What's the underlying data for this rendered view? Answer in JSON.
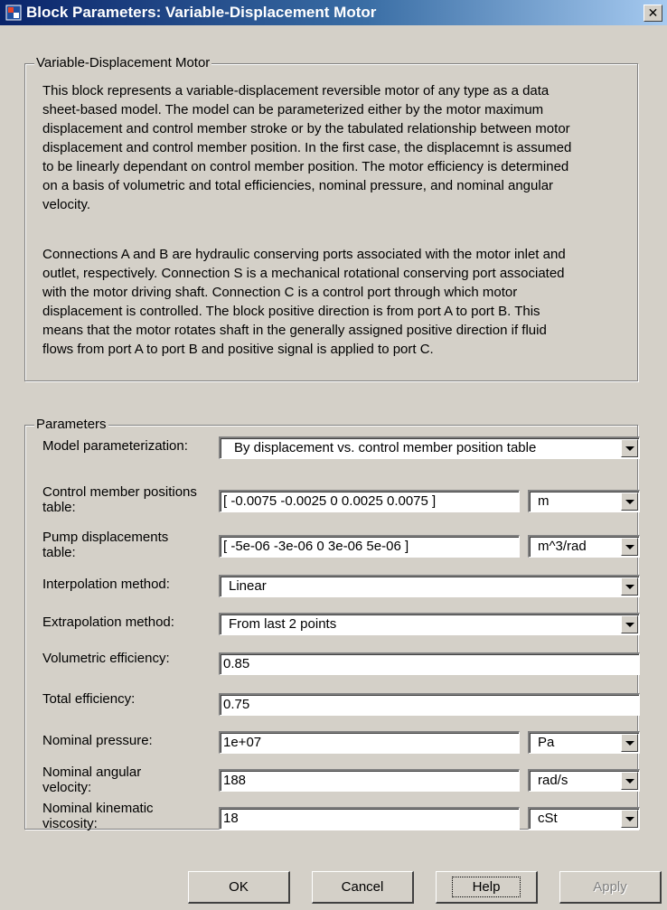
{
  "window": {
    "title": "Block Parameters: Variable-Displacement Motor",
    "close_glyph": "✕"
  },
  "description": {
    "group_title": "Variable-Displacement Motor",
    "paragraph1": "This block represents  a  variable-displacement reversible motor of any type as a data\nsheet-based model. The model can be parameterized either by the motor maximum\ndisplacement and control member stroke or by the tabulated relationship between motor\ndisplacement and control member position. In the first case, the displacemnt is assumed\nto be linearly dependant on control member position. The motor efficiency is determined\non a basis of volumetric and total efficiencies, nominal pressure, and nominal angular\nvelocity.",
    "paragraph2": "Connections A and B are hydraulic conserving ports associated with the motor inlet and\noutlet, respectively. Connection S is a mechanical rotational conserving port associated\nwith the motor driving shaft. Connection C is a control port through which motor\ndisplacement is controlled. The block positive direction is from port A to port B. This\nmeans that the motor rotates shaft in the generally assigned positive direction if fluid\nflows from port A to port B and positive signal is applied to port C."
  },
  "parameters": {
    "group_title": "Parameters",
    "model_param": {
      "label": "Model parameterization:",
      "value": "By displacement vs. control member position table"
    },
    "control_positions": {
      "label": "Control member positions\ntable:",
      "value": "[  -0.0075 -0.0025 0 0.0025 0.0075 ]",
      "unit": "m"
    },
    "pump_displacements": {
      "label": "Pump displacements\ntable:",
      "value": "[  -5e-06 -3e-06 0 3e-06 5e-06 ]",
      "unit": "m^3/rad"
    },
    "interpolation": {
      "label": "Interpolation method:",
      "value": "Linear"
    },
    "extrapolation": {
      "label": "Extrapolation method:",
      "value": "From last 2 points"
    },
    "volumetric_eff": {
      "label": "Volumetric efficiency:",
      "value": "0.85"
    },
    "total_eff": {
      "label": "Total efficiency:",
      "value": "0.75"
    },
    "nominal_pressure": {
      "label": "Nominal pressure:",
      "value": "1e+07",
      "unit": "Pa"
    },
    "nominal_velocity": {
      "label": "Nominal angular\nvelocity:",
      "value": "188",
      "unit": "rad/s"
    },
    "nominal_viscosity": {
      "label": "Nominal kinematic\nviscosity:",
      "value": "18",
      "unit": "cSt"
    }
  },
  "buttons": {
    "ok": "OK",
    "cancel": "Cancel",
    "help": "Help",
    "apply": "Apply"
  },
  "icons": {
    "app": "simulink-block-icon",
    "close": "close-icon",
    "dropdown": "chevron-down-icon"
  }
}
